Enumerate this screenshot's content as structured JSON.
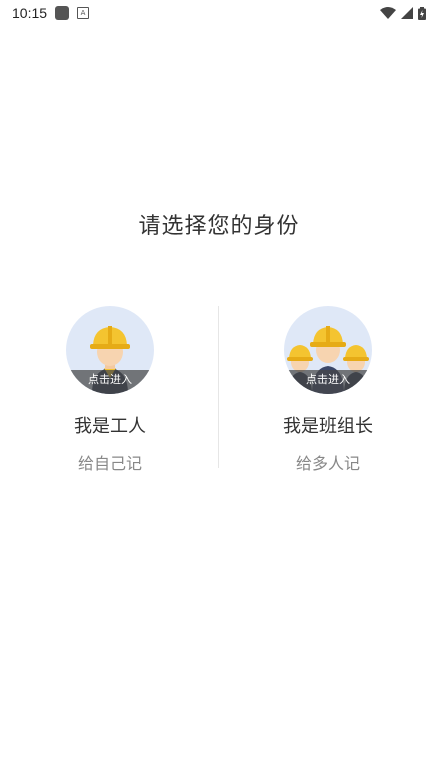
{
  "status_bar": {
    "time": "10:15"
  },
  "page": {
    "title": "请选择您的身份"
  },
  "options": [
    {
      "title": "我是工人",
      "subtitle": "给自己记",
      "enter_label": "点击进入"
    },
    {
      "title": "我是班组长",
      "subtitle": "给多人记",
      "enter_label": "点击进入"
    }
  ],
  "colors": {
    "avatar_bg": "#dfe8f7",
    "helmet": "#f4c430",
    "band": "#464646"
  }
}
